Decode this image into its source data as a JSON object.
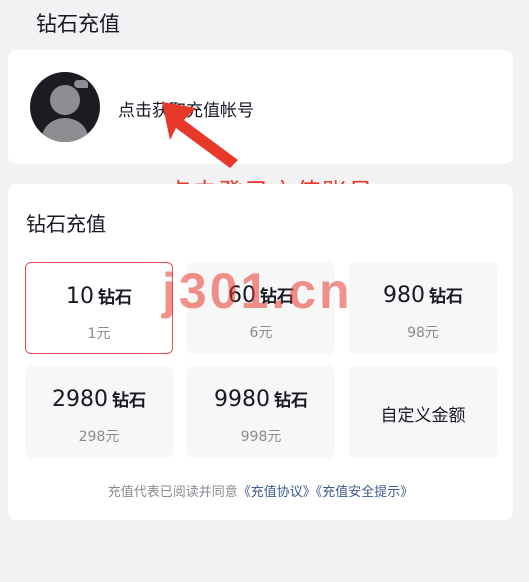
{
  "page": {
    "title": "钻石充值"
  },
  "account": {
    "login_label": "点击获取充值帐号"
  },
  "annotation": {
    "text": "点击登录充值账号",
    "color": "#e8382a"
  },
  "recharge": {
    "title": "钻石充值",
    "options": [
      {
        "amount": "10",
        "unit": "钻石",
        "price": "1元",
        "selected": true
      },
      {
        "amount": "60",
        "unit": "钻石",
        "price": "6元",
        "selected": false
      },
      {
        "amount": "980",
        "unit": "钻石",
        "price": "98元",
        "selected": false
      },
      {
        "amount": "2980",
        "unit": "钻石",
        "price": "298元",
        "selected": false
      },
      {
        "amount": "9980",
        "unit": "钻石",
        "price": "998元",
        "selected": false
      },
      {
        "custom_label": "自定义金额",
        "selected": false
      }
    ],
    "agreement": {
      "prefix": "充值代表已阅读并同意",
      "link1": "《充值协议》",
      "link2": "《充值安全提示》"
    }
  },
  "watermark": "j301.cn",
  "colors": {
    "selected_border": "#e8484e",
    "link": "#3c5a8c",
    "annotation": "#e8382a"
  }
}
